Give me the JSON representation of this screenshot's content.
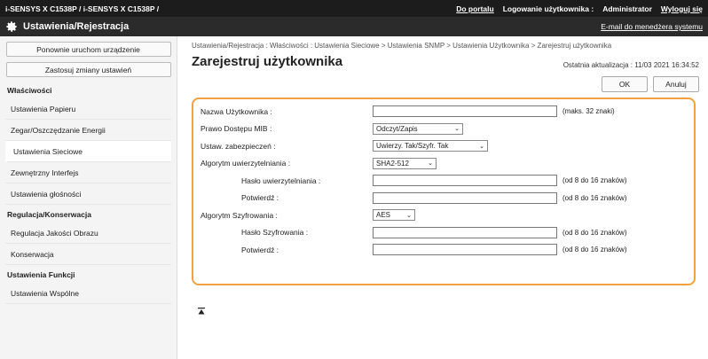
{
  "topbar": {
    "device": "i-SENSYS X C1538P / i-SENSYS X C1538P /",
    "links": [
      "Do portalu",
      "Logowanie użytkownika :",
      "Administrator",
      "Wyloguj się"
    ]
  },
  "titlebar": {
    "title": "Ustawienia/Rejestracja",
    "right": "E-mail do menedżera systemu"
  },
  "sidebar": {
    "restart_label": "Ponownie uruchom urządzenie",
    "apply_label": "Zastosuj zmiany ustawień",
    "sections": [
      {
        "title": "Właściwości",
        "items": [
          "Ustawienia Papieru",
          "Zegar/Oszczędzanie Energii",
          "Ustawienia Sieciowe",
          "Zewnętrzny Interfejs",
          "Ustawienia głośności"
        ]
      },
      {
        "title": "Regulacja/Konserwacja",
        "items": [
          "Regulacja Jakości Obrazu",
          "Konserwacja"
        ]
      },
      {
        "title": "Ustawienia Funkcji",
        "items": [
          "Ustawienia Wspólne"
        ]
      }
    ],
    "active": "Ustawienia Sieciowe"
  },
  "main": {
    "breadcrumb": "Ustawienia/Rejestracja : Właściwości : Ustawienia Sieciowe > Ustawienia SNMP > Ustawienia Użytkownika > Zarejestruj użytkownika",
    "title": "Zarejestruj użytkownika",
    "updated": "Ostatnia aktualizacja : 11/03 2021 16:34:52",
    "ok_label": "OK",
    "cancel_label": "Anuluj"
  },
  "form": {
    "username_label": "Nazwa Użytkownika :",
    "username_value": "",
    "username_hint": "(maks. 32 znaki)",
    "mib_label": "Prawo Dostępu MIB :",
    "mib_value": "Odczyt/Zapis",
    "security_label": "Ustaw. zabezpieczeń :",
    "security_value": "Uwierzy. Tak/Szyfr. Tak",
    "auth_algo_label": "Algorytm uwierzytelniania :",
    "auth_algo_value": "SHA2-512",
    "auth_pass_label": "Hasło uwierzytelniania :",
    "auth_pass_hint": "(od 8 do 16 znaków)",
    "auth_confirm_label": "Potwierdź :",
    "auth_confirm_hint": "(od 8 do 16 znaków)",
    "enc_algo_label": "Algorytm Szyfrowania :",
    "enc_algo_value": "AES",
    "enc_pass_label": "Hasło Szyfrowania :",
    "enc_pass_hint": "(od 8 do 16 znaków)",
    "enc_confirm_label": "Potwierdź :",
    "enc_confirm_hint": "(od 8 do 16 znaków)"
  },
  "colors": {
    "accent_border": "#f2a23c",
    "topbar": "#1c1c1c",
    "titlebar": "#2b2b2b"
  }
}
